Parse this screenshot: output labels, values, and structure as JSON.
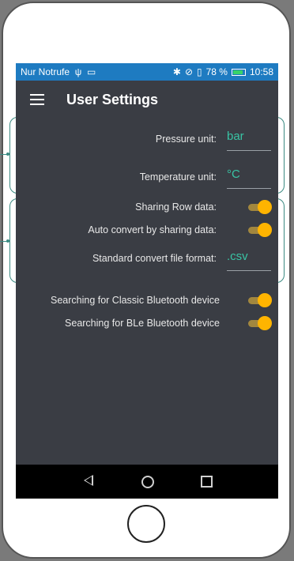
{
  "status_bar": {
    "carrier": "Nur Notrufe",
    "battery_percent": "78 %",
    "time": "10:58"
  },
  "app_bar": {
    "title": "User Settings"
  },
  "units_group": {
    "pressure_label": "Pressure unit:",
    "pressure_value": "bar",
    "temperature_label": "Temperature unit:",
    "temperature_value": "°C"
  },
  "sharing_group": {
    "sharing_row_label": "Sharing Row data:",
    "sharing_row_on": true,
    "auto_convert_label": "Auto convert by sharing data:",
    "auto_convert_on": true,
    "file_format_label": "Standard convert file format:",
    "file_format_value": ".csv"
  },
  "bluetooth": {
    "classic_label": "Searching for Classic Bluetooth device",
    "classic_on": true,
    "ble_label": "Searching for BLe Bluetooth device",
    "ble_on": true
  },
  "colors": {
    "status_bar": "#1e7bc1",
    "screen_bg": "#3a3d44",
    "accent_value": "#39c4a4",
    "toggle_thumb": "#ffb400",
    "group_border": "#3a8a82"
  },
  "icons": [
    "menu-icon",
    "usb-icon",
    "image-icon",
    "bluetooth-icon",
    "vibrate-icon",
    "sim-icon",
    "battery-icon",
    "back-icon",
    "home-icon",
    "recent-apps-icon"
  ]
}
